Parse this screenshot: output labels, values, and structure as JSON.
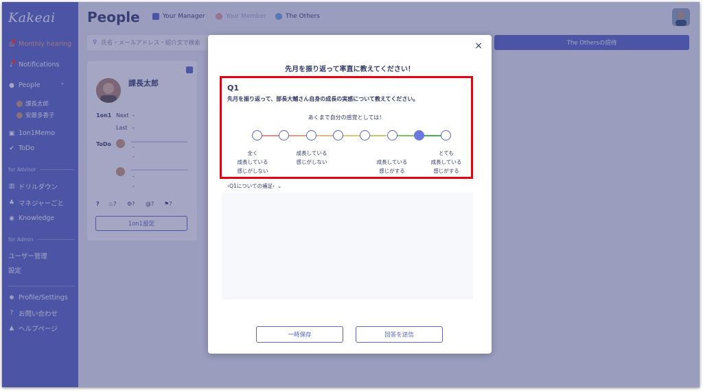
{
  "sidebar": {
    "logo": "Kakeai",
    "items": [
      {
        "label": "Monthly hearing",
        "icon": "clipboard-icon"
      },
      {
        "label": "Notifications",
        "icon": "bell-icon"
      },
      {
        "label": "People",
        "icon": "person-icon"
      },
      {
        "label": "1on1Memo",
        "icon": "memo-icon"
      },
      {
        "label": "ToDo",
        "icon": "check-icon"
      }
    ],
    "people_sub": [
      "課長太郎",
      "安藤多香子"
    ],
    "advisor_section": "for Advisor",
    "advisor_items": [
      "ドリルダウン",
      "マネジャーごと",
      "Knowledge"
    ],
    "admin_section": "for Admin",
    "admin_items": [
      "ユーザー管理",
      "設定"
    ],
    "bottom_items": [
      "Profile/Settings",
      "お問い合わせ",
      "ヘルプページ"
    ]
  },
  "header": {
    "title": "People",
    "tabs": [
      "Your Manager",
      "Your Member",
      "The Others"
    ]
  },
  "search": {
    "placeholder": "氏名・メールアドレス・紹介文で検索"
  },
  "invite_button": "The Othersの招待",
  "card": {
    "name": "課長太郎",
    "oneonone_label": "1on1",
    "next_label": "Next",
    "next_value": "-",
    "last_label": "Last",
    "last_value": "-",
    "todo_label": "ToDo",
    "dash": "-",
    "q_marks": [
      "?",
      "?",
      "?",
      "?",
      "?"
    ],
    "setup_button": "1on1設定"
  },
  "modal": {
    "close": "×",
    "title": "先月を振り返って率直に教えてください！",
    "q_label": "Q1",
    "q_text": "先月を振り返って、部長大輔さん自身の成長の実感について教えてください。",
    "hint": "あくまで自分の感覚としては！",
    "scale_points": 8,
    "selected_index": 6,
    "scale_labels": [
      "全く\n成長している\n感じがしない",
      "成長している\n感じがしない",
      "成長している\n感じがする",
      "とても\n成長している\n感じがする"
    ],
    "supplement": "‹Q1についての補足›",
    "save_button": "一時保存",
    "submit_button": "回答を送信"
  },
  "colors": {
    "sidebar": "#5763c7",
    "accent": "#5763c7",
    "highlight": "#e60012",
    "selected": "#6a79e0"
  }
}
